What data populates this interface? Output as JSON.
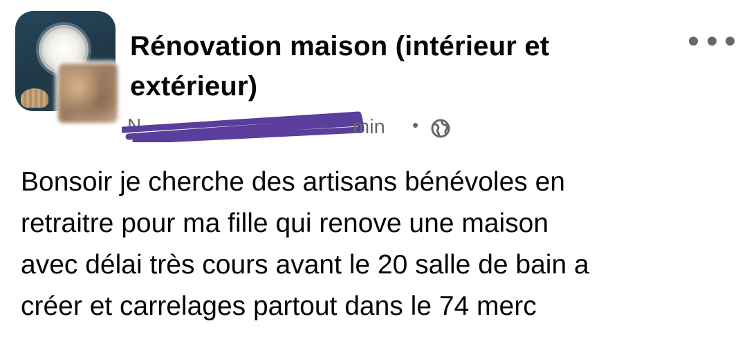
{
  "group": {
    "title_line1": "Rénovation maison (intérieur et",
    "title_line2": "extérieur)"
  },
  "meta": {
    "author": "N",
    "time": "min",
    "separator": "•",
    "privacy_icon": "globe-icon"
  },
  "menu": {
    "icon": "more-horizontal-icon"
  },
  "post": {
    "lines": [
      "Bonsoir je cherche des artisans bénévoles en",
      "retraitre pour ma fille qui renove une maison",
      "avec délai très cours avant le 20 salle de bain a",
      "créer et carrelages partout dans le 74 merc"
    ]
  },
  "colors": {
    "text": "#050505",
    "secondary": "#65676b",
    "redaction": "#5b3d9c"
  }
}
